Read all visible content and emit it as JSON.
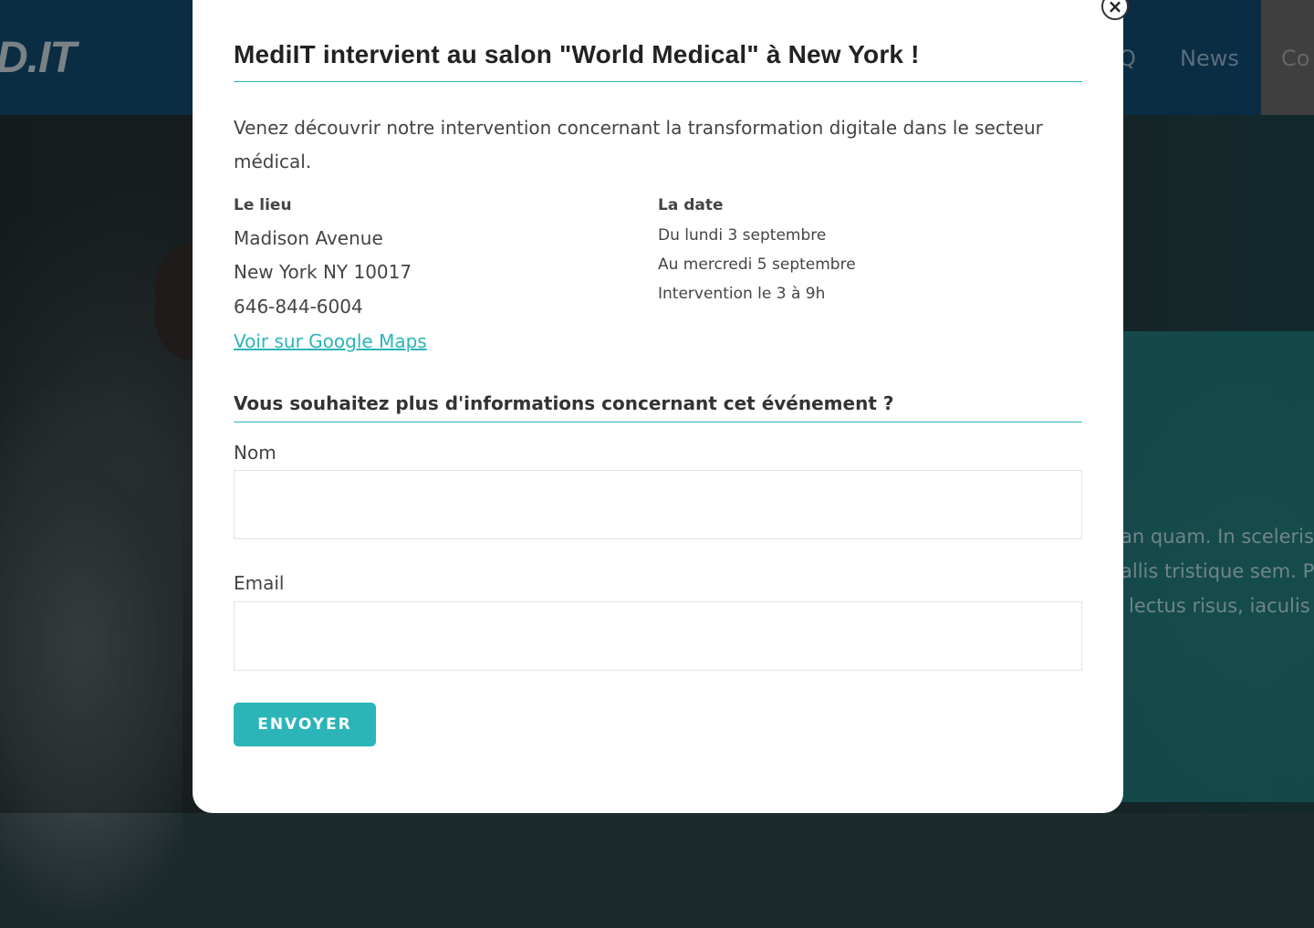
{
  "background_page": {
    "logo": "D.IT",
    "nav": {
      "faq_fragment": "Q",
      "news": "News",
      "contact_fragment": "Co"
    },
    "text_fragments": [
      "an quam. In sceleris",
      "allis tristique sem. P",
      "lectus risus, iaculis"
    ]
  },
  "modal": {
    "close_icon": "×",
    "title": "MediIT intervient au salon \"World Medical\" à New York !",
    "intro": "Venez découvrir notre intervention concernant la transformation digitale dans le secteur médical.",
    "location": {
      "heading": "Le lieu",
      "lines": [
        "Madison Avenue",
        "New York NY 10017",
        "646-844-6004"
      ],
      "maps_link": "Voir sur Google Maps"
    },
    "date": {
      "heading": "La date",
      "lines": [
        "Du lundi 3 septembre",
        "Au mercredi 5 septembre",
        "Intervention le 3 à 9h"
      ]
    },
    "form": {
      "title": "Vous souhaitez plus d'informations concernant cet événement ?",
      "name_label": "Nom",
      "name_value": "",
      "email_label": "Email",
      "email_value": "",
      "submit_label": "ENVOYER"
    }
  },
  "colors": {
    "accent": "#2cb5b8",
    "header_bg": "#0f3f5f",
    "overlay_teal": "#1e7072"
  }
}
